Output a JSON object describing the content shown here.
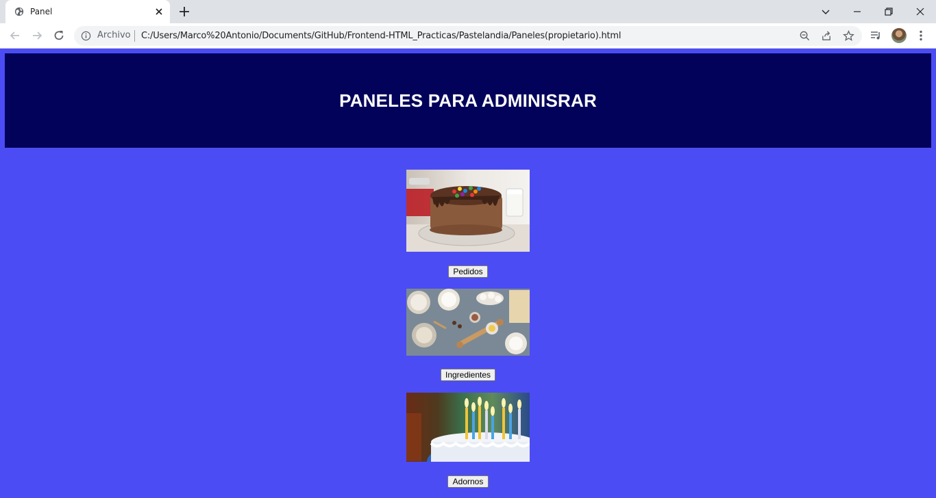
{
  "browser": {
    "tab_title": "Panel",
    "address_label": "Archivo",
    "url": "C:/Users/Marco%20Antonio/Documents/GitHub/Frontend-HTML_Practicas/Pastelandia/Paneles(propietario).html"
  },
  "page": {
    "title": "PANELES PARA ADMINISRAR",
    "background_color": "#4c4cf5",
    "banner_color": "#02025a",
    "panels": [
      {
        "image": "chocolate-cake-with-candies",
        "button_label": "Pedidos"
      },
      {
        "image": "baking-ingredients-flatlay",
        "button_label": "Ingredientes"
      },
      {
        "image": "birthday-cake-with-candles",
        "button_label": "Adornos"
      }
    ]
  }
}
